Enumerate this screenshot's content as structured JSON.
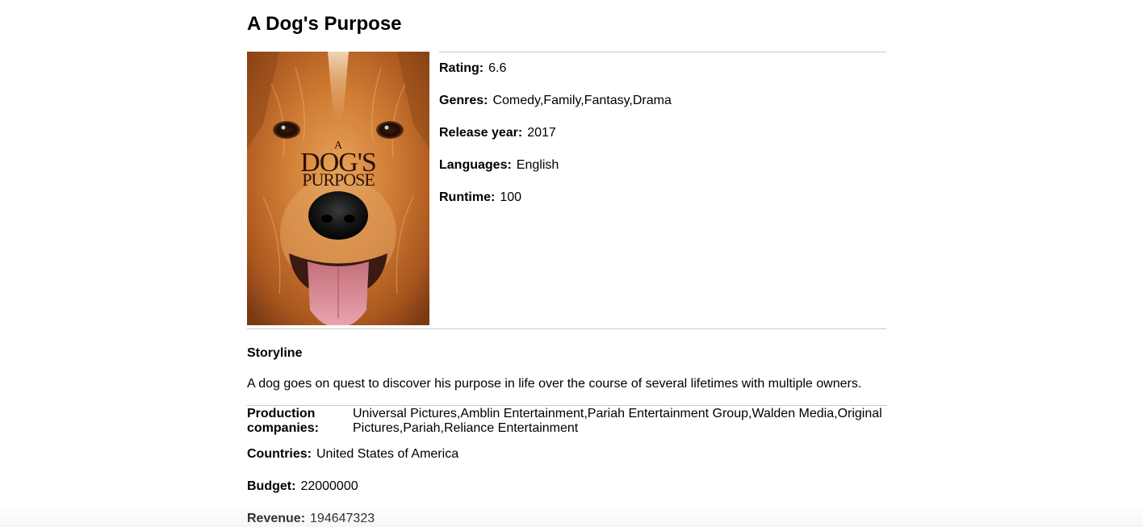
{
  "movie": {
    "title": "A Dog's Purpose",
    "poster": {
      "title_line1": "A",
      "title_line2": "DOG'S",
      "title_line3": "PURPOSE"
    },
    "details": {
      "rating": {
        "label": "Rating:",
        "value": "6.6"
      },
      "genres": {
        "label": "Genres:",
        "value": "Comedy,Family,Fantasy,Drama"
      },
      "release_year": {
        "label": "Release year:",
        "value": "2017"
      },
      "languages": {
        "label": "Languages:",
        "value": "English"
      },
      "runtime": {
        "label": "Runtime:",
        "value": "100"
      }
    },
    "storyline": {
      "heading": "Storyline",
      "text": "A dog goes on quest to discover his purpose in life over the course of several lifetimes with multiple owners."
    },
    "production": {
      "label_line1": "Production",
      "label_line2": "companies:",
      "value_line1": "Universal Pictures,Amblin Entertainment,Pariah Entertainment Group,Walden Media,Original",
      "value_line2": "Pictures,Pariah,Reliance Entertainment"
    },
    "countries": {
      "label": "Countries:",
      "value": "United States of America"
    },
    "budget": {
      "label": "Budget:",
      "value": "22000000"
    },
    "revenue": {
      "label": "Revenue:",
      "value": "194647323"
    }
  }
}
